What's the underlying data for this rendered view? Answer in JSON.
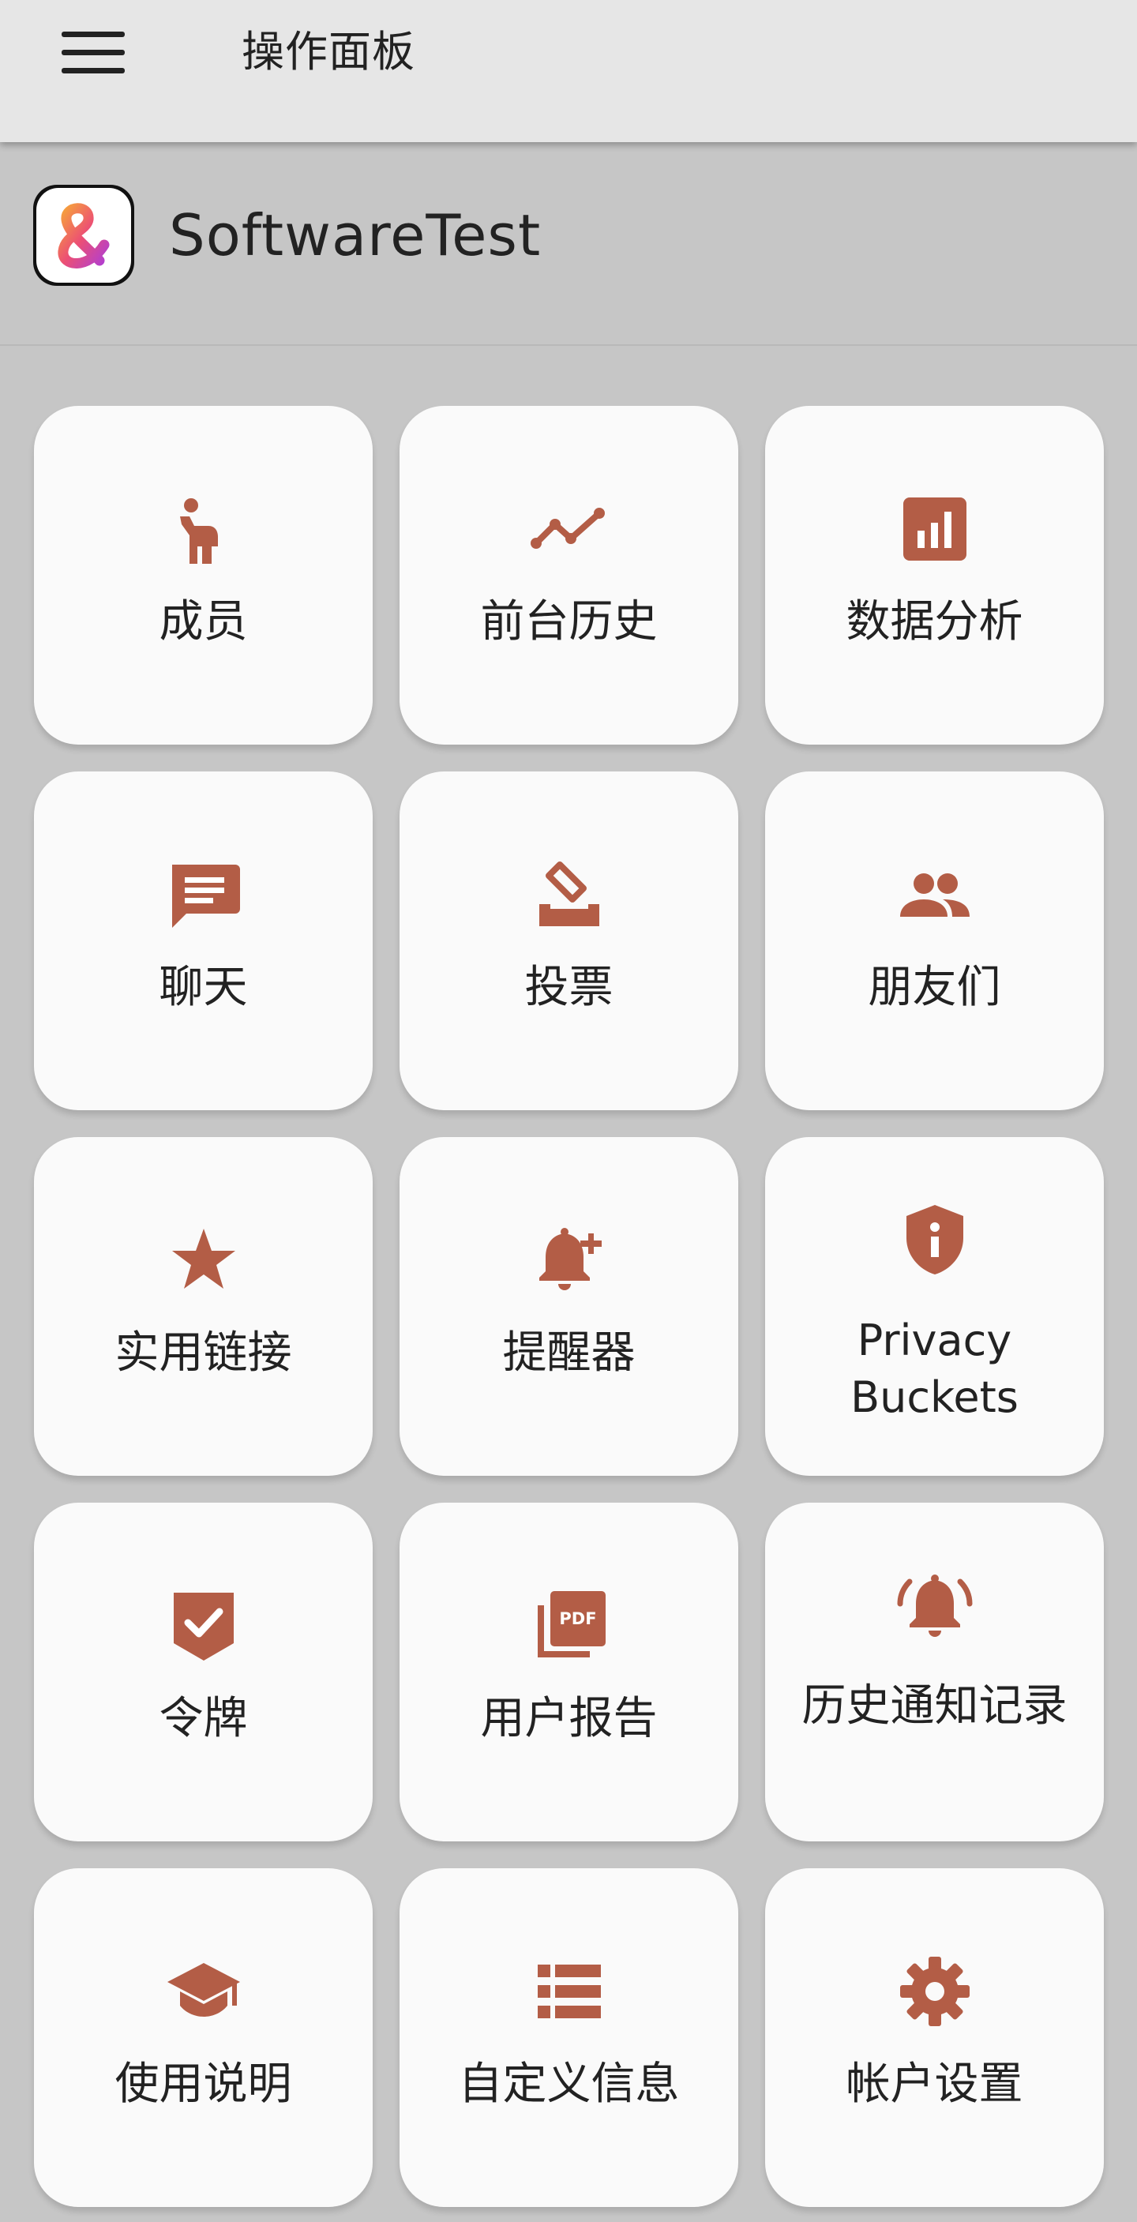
{
  "appbar": {
    "title": "操作面板",
    "menu_icon": "menu-icon"
  },
  "org": {
    "name": "SoftwareTest",
    "logo_icon": "ampersand-logo"
  },
  "colors": {
    "accent": "#b35d46",
    "background": "#c6c6c6",
    "appbar": "#e6e6e6",
    "tile": "#fafafa",
    "text": "#222222"
  },
  "tiles": [
    {
      "label": "成员",
      "icon": "person-icon"
    },
    {
      "label": "前台历史",
      "icon": "trend-line-icon"
    },
    {
      "label": "数据分析",
      "icon": "analytics-icon"
    },
    {
      "label": "聊天",
      "icon": "chat-icon"
    },
    {
      "label": "投票",
      "icon": "ballot-icon"
    },
    {
      "label": "朋友们",
      "icon": "people-icon"
    },
    {
      "label": "实用链接",
      "icon": "star-icon"
    },
    {
      "label": "提醒器",
      "icon": "add-alert-icon"
    },
    {
      "label": "Privacy Buckets",
      "icon": "shield-info-icon"
    },
    {
      "label": "令牌",
      "icon": "verified-badge-icon"
    },
    {
      "label": "用户报告",
      "icon": "pdf-icon"
    },
    {
      "label": "历史通知记录",
      "icon": "ringing-bell-icon"
    },
    {
      "label": "使用说明",
      "icon": "school-icon"
    },
    {
      "label": "自定义信息",
      "icon": "list-icon"
    },
    {
      "label": "帐户设置",
      "icon": "gear-icon"
    }
  ]
}
